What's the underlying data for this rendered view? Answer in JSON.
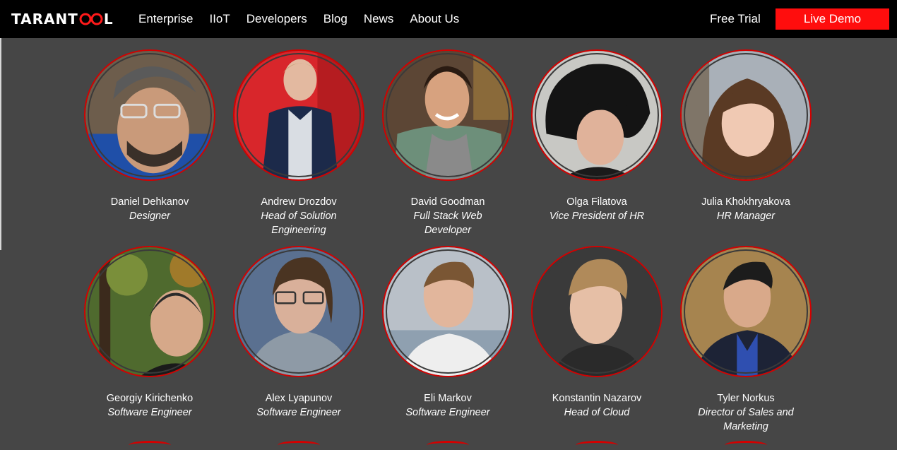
{
  "header": {
    "logo_left": "TARANT",
    "logo_right": "L",
    "nav": [
      {
        "label": "Enterprise"
      },
      {
        "label": "IIoT"
      },
      {
        "label": "Developers"
      },
      {
        "label": "Blog"
      },
      {
        "label": "News"
      },
      {
        "label": "About Us"
      }
    ],
    "free_trial": "Free Trial",
    "live_demo": "Live Demo"
  },
  "colors": {
    "accent": "#ff0d0d",
    "background": "#464646",
    "header": "#000000"
  },
  "team": [
    {
      "name": "Daniel Dehkanov",
      "role": "Designer"
    },
    {
      "name": "Andrew Drozdov",
      "role": "Head of Solution Engineering"
    },
    {
      "name": "David Goodman",
      "role": "Full Stack Web Developer"
    },
    {
      "name": "Olga Filatova",
      "role": "Vice President of HR"
    },
    {
      "name": "Julia Khokhryakova",
      "role": "HR Manager"
    },
    {
      "name": "Georgiy Kirichenko",
      "role": "Software Engineer"
    },
    {
      "name": "Alex Lyapunov",
      "role": "Software Engineer"
    },
    {
      "name": "Eli Markov",
      "role": "Software Engineer"
    },
    {
      "name": "Konstantin Nazarov",
      "role": "Head of Cloud"
    },
    {
      "name": "Tyler Norkus",
      "role": "Director of Sales and Marketing"
    }
  ]
}
